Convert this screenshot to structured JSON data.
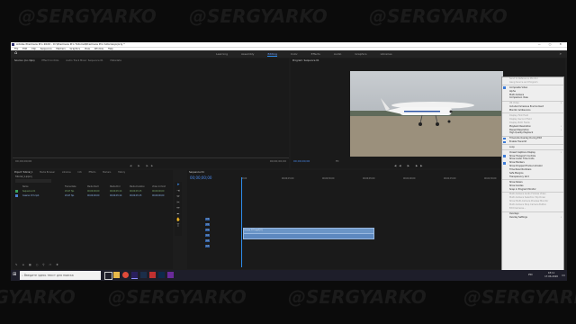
{
  "watermark": "@SERGYARKO",
  "window": {
    "title": "Adobe Premiere Pro 2020 - D:\\Premiere Pro Tutorial\\Premiere Pro tutorial.prproj *",
    "controls": [
      "—",
      "▢",
      "✕"
    ]
  },
  "menu": [
    "File",
    "Edit",
    "Clip",
    "Sequence",
    "Markers",
    "Graphics",
    "View",
    "Window",
    "Help"
  ],
  "workspaces": {
    "items": [
      "Learning",
      "Assembly",
      "Editing",
      "Color",
      "Effects",
      "Audio",
      "Graphics",
      "Libraries"
    ],
    "active": "Editing"
  },
  "source_panel": {
    "tabs": [
      "Source: (no clips)",
      "Effect Controls",
      "Audio Track Mixer: Sequence 01",
      "Metadata"
    ],
    "timecode_left": "00;00;00;00",
    "timecode_right": "00;00;00;00"
  },
  "program_panel": {
    "tab": "Program: Sequence 01",
    "timecode": "00;00;00;00",
    "fit": "Fit"
  },
  "project_panel": {
    "tabs": [
      "Project: Tutorial_1",
      "Media Browser",
      "Libraries",
      "Info",
      "Effects",
      "Markers",
      "History"
    ],
    "project_file": "Tutorial_1.prproj",
    "columns": [
      "Name",
      "Frame Rate",
      "Media Start",
      "Media End",
      "Media Duration",
      "Video In Point"
    ],
    "rows": [
      {
        "name": "Sequence 01",
        "frame_rate": "29,97 fps",
        "media_start": "00;00;00;00",
        "media_end": "00;00;45;14",
        "duration": "00;00;45;15",
        "in_point": "00;00;00;00"
      },
      {
        "name": "Cessna 172.mp4",
        "frame_rate": "29,97 fps",
        "media_start": "00;00;00;00",
        "media_end": "00;00;45;14",
        "duration": "00;00;45;15",
        "in_point": "00;00;00;00"
      }
    ]
  },
  "timeline": {
    "tab": "Sequence 01",
    "timecode": "00;00;00;00",
    "ruler": [
      "00;00",
      "00;00;15;00",
      "00;00;30;00",
      "00;00;45;00",
      "00;01;00;00",
      "00;01;15;00",
      "00;01;30;00",
      "00;01;45;00"
    ],
    "tracks": [
      "V3",
      "V2",
      "V1",
      "A1",
      "A2",
      "A3"
    ],
    "video_clip": "Cessna 172.mp4 [V]"
  },
  "settings_menu": {
    "items": [
      {
        "label": "Send to Reference Monitor",
        "state": "disabled"
      },
      {
        "label": "Gang Source and Program",
        "state": "disabled"
      },
      {
        "label": "",
        "state": "sep"
      },
      {
        "label": "Composite Video",
        "state": "checked"
      },
      {
        "label": "Alpha",
        "state": "normal"
      },
      {
        "label": "Multi-Camera",
        "state": "normal"
      },
      {
        "label": "Comparison View",
        "state": "normal"
      },
      {
        "label": "",
        "state": "sep"
      },
      {
        "label": "VR Video",
        "state": "submenu-disabled"
      },
      {
        "label": "Include Immersive Environment",
        "state": "normal"
      },
      {
        "label": "Monitor Ambisonics",
        "state": "normal"
      },
      {
        "label": "",
        "state": "sep"
      },
      {
        "label": "Display First Field",
        "state": "disabled"
      },
      {
        "label": "Display Second Field",
        "state": "disabled"
      },
      {
        "label": "Display Both Fields",
        "state": "disabled"
      },
      {
        "label": "Playback Resolution",
        "state": "submenu"
      },
      {
        "label": "Paused Resolution",
        "state": "submenu"
      },
      {
        "label": "High Quality Playback",
        "state": "normal"
      },
      {
        "label": "",
        "state": "sep"
      },
      {
        "label": "Timecode Overlay During Edit",
        "state": "checked"
      },
      {
        "label": "Enable Transmit",
        "state": "checked"
      },
      {
        "label": "",
        "state": "sep"
      },
      {
        "label": "Loop",
        "state": "normal"
      },
      {
        "label": "",
        "state": "sep"
      },
      {
        "label": "Closed Captions Display",
        "state": "submenu"
      },
      {
        "label": "Show Transport Controls",
        "state": "checked"
      },
      {
        "label": "Show Audio Time Units",
        "state": "normal"
      },
      {
        "label": "Show Markers",
        "state": "checked"
      },
      {
        "label": "Show Dropped Frame Indicator",
        "state": "normal"
      },
      {
        "label": "Time Ruler Numbers",
        "state": "normal"
      },
      {
        "label": "Safe Margins",
        "state": "normal"
      },
      {
        "label": "Transparency Grid",
        "state": "normal"
      },
      {
        "label": "",
        "state": "sep"
      },
      {
        "label": "Show Rulers",
        "state": "normal"
      },
      {
        "label": "Show Guides",
        "state": "normal"
      },
      {
        "label": "Snap in Program Monitor",
        "state": "normal"
      },
      {
        "label": "",
        "state": "sep"
      },
      {
        "label": "Multi-Camera Audio Follows Video",
        "state": "disabled"
      },
      {
        "label": "Multi-Camera Selection Top Down",
        "state": "disabled"
      },
      {
        "label": "Show Multi-Camera Preview Monitor",
        "state": "disabled"
      },
      {
        "label": "Multi-Camera Stop Camera Button",
        "state": "disabled"
      },
      {
        "label": "Edit Cameras...",
        "state": "disabled"
      },
      {
        "label": "",
        "state": "sep"
      },
      {
        "label": "Overlays",
        "state": "normal"
      },
      {
        "label": "Overlay Settings",
        "state": "submenu"
      }
    ]
  },
  "taskbar": {
    "search_placeholder": "Введите здесь текст для поиска",
    "time": "18:11",
    "date": "17.06.2020",
    "lang": "РУС"
  }
}
